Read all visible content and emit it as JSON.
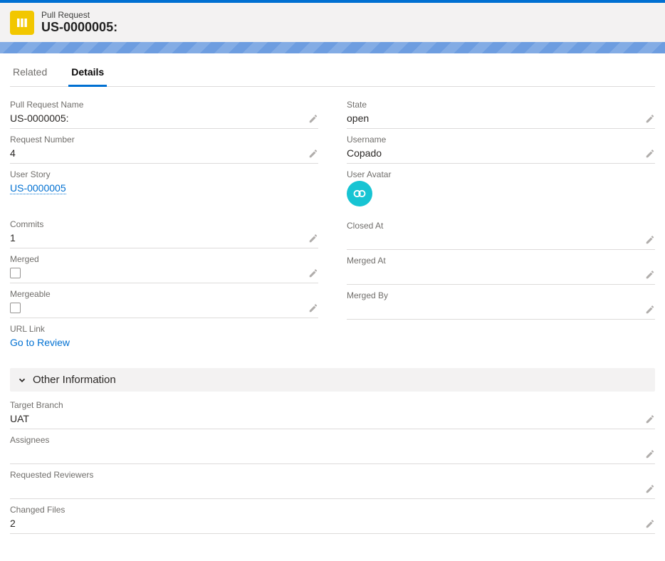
{
  "header": {
    "type": "Pull Request",
    "title": "US-0000005:"
  },
  "tabs": {
    "related": "Related",
    "details": "Details"
  },
  "left": {
    "pr_name": {
      "label": "Pull Request Name",
      "value": "US-0000005:"
    },
    "req_num": {
      "label": "Request Number",
      "value": "4"
    },
    "user_story": {
      "label": "User Story",
      "value": "US-0000005"
    },
    "commits": {
      "label": "Commits",
      "value": "1"
    },
    "merged": {
      "label": "Merged"
    },
    "mergeable": {
      "label": "Mergeable"
    },
    "url_link": {
      "label": "URL Link",
      "value": "Go to Review"
    }
  },
  "right": {
    "state": {
      "label": "State",
      "value": "open"
    },
    "username": {
      "label": "Username",
      "value": "Copado"
    },
    "avatar": {
      "label": "User Avatar"
    },
    "closed_at": {
      "label": "Closed At",
      "value": ""
    },
    "merged_at": {
      "label": "Merged At",
      "value": ""
    },
    "merged_by": {
      "label": "Merged By",
      "value": ""
    }
  },
  "section": {
    "other_info": "Other Information"
  },
  "other": {
    "target_branch": {
      "label": "Target Branch",
      "value": "UAT"
    },
    "assignees": {
      "label": "Assignees",
      "value": ""
    },
    "requested_reviewers": {
      "label": "Requested Reviewers",
      "value": ""
    },
    "changed_files": {
      "label": "Changed Files",
      "value": "2"
    }
  }
}
